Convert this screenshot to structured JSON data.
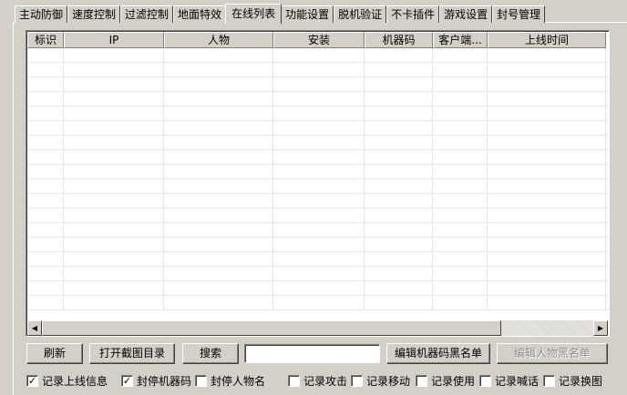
{
  "tabs": [
    {
      "label": "主动防御"
    },
    {
      "label": "速度控制"
    },
    {
      "label": "过滤控制"
    },
    {
      "label": "地面特效"
    },
    {
      "label": "在线列表"
    },
    {
      "label": "功能设置"
    },
    {
      "label": "脱机验证"
    },
    {
      "label": "不卡插件"
    },
    {
      "label": "游戏设置"
    },
    {
      "label": "封号管理"
    }
  ],
  "active_tab": "在线列表",
  "list": {
    "columns": [
      "标识",
      "IP",
      "人物",
      "安装",
      "机器码",
      "客户端...",
      "上线时间"
    ],
    "rows": []
  },
  "buttons": {
    "refresh": "刷新",
    "open_screenshot_dir": "打开截图目录",
    "search": "搜索",
    "edit_machine_blacklist": "编辑机器码黑名单",
    "edit_player_blacklist": "编辑人物黑名单"
  },
  "search": {
    "value": ""
  },
  "checkboxes": [
    {
      "label": "记录上线信息",
      "checked": true
    },
    {
      "label": "封停机器码",
      "checked": true
    },
    {
      "label": "封停人物名",
      "checked": false
    },
    {
      "label": "记录攻击",
      "checked": false
    },
    {
      "label": "记录移动",
      "checked": false
    },
    {
      "label": "记录使用",
      "checked": false
    },
    {
      "label": "记录喊话",
      "checked": false
    },
    {
      "label": "记录换图",
      "checked": false
    }
  ]
}
